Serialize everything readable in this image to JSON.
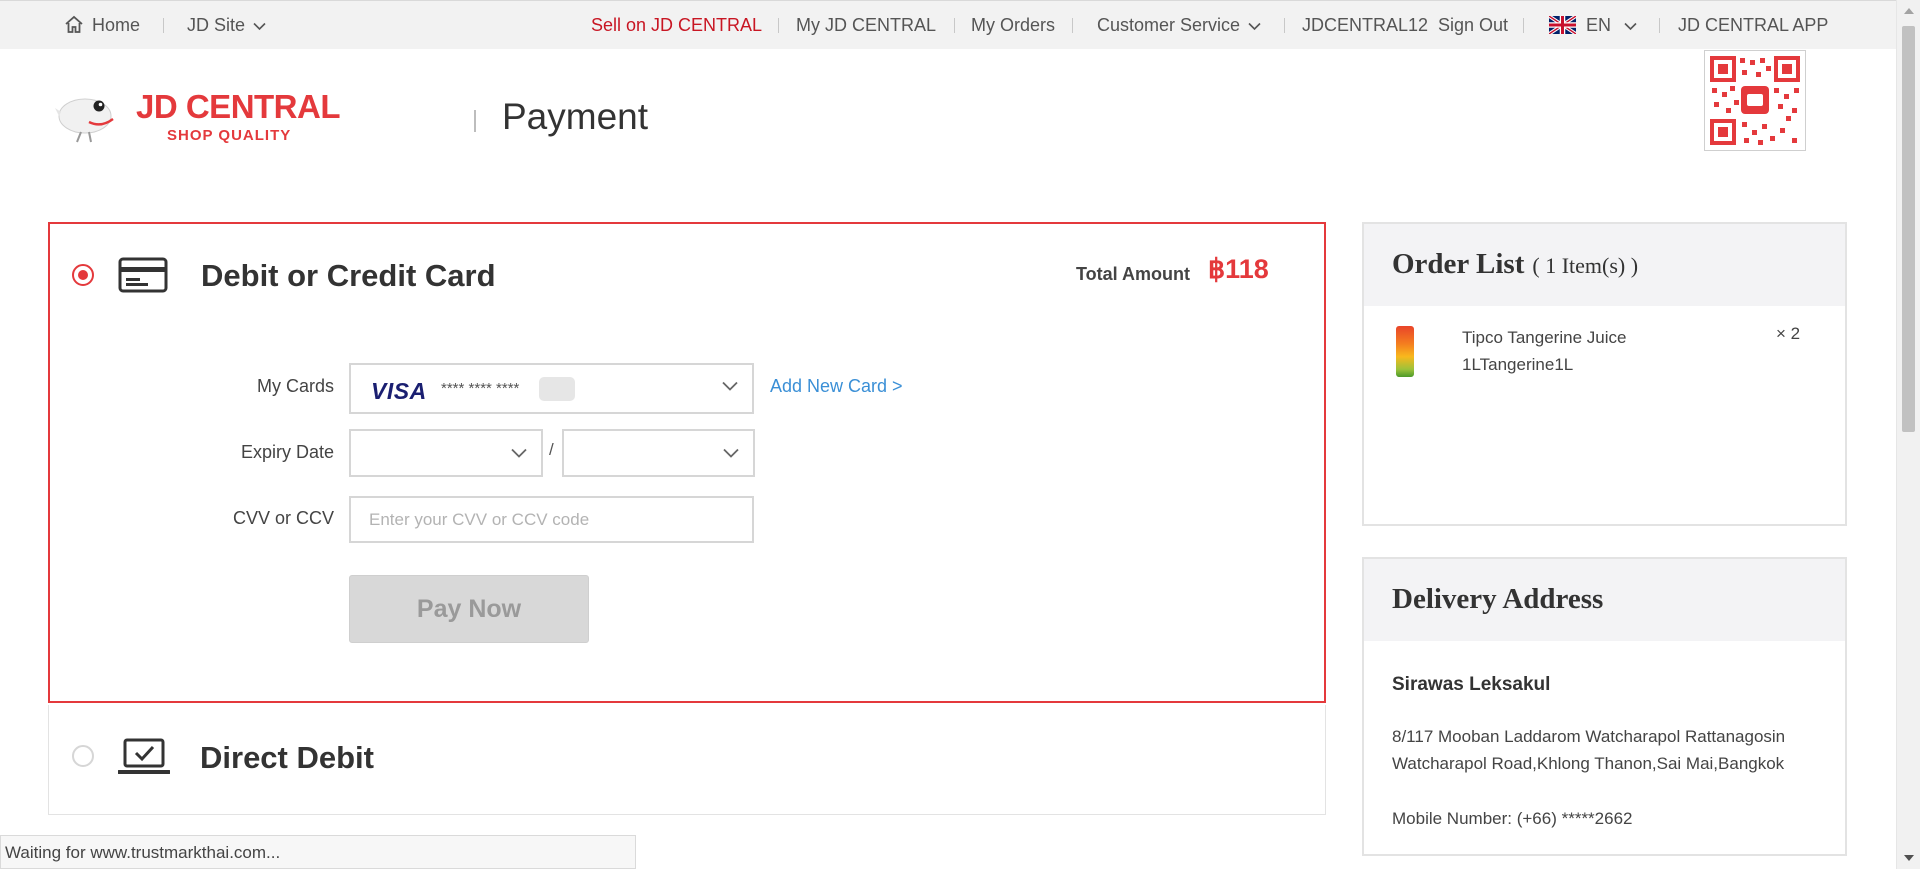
{
  "topbar": {
    "home": "Home",
    "site": "JD Site",
    "sell": "Sell on JD CENTRAL",
    "my_account": "My JD CENTRAL",
    "my_orders": "My Orders",
    "customer_service": "Customer Service",
    "username": "JDCENTRAL12",
    "sign_out": "Sign Out",
    "language": "EN",
    "app": "JD CENTRAL APP"
  },
  "header": {
    "logo_text": "JD CENTRAL",
    "logo_tagline": "SHOP QUALITY",
    "page_title": "Payment"
  },
  "payment": {
    "card_method": {
      "title": "Debit or Credit Card",
      "selected": true,
      "total_label": "Total Amount",
      "total_value": "฿118",
      "my_cards_label": "My Cards",
      "card_brand": "VISA",
      "card_masked": "**** **** ****",
      "add_card": "Add New Card >",
      "expiry_label": "Expiry Date",
      "expiry_month": "",
      "expiry_year": "",
      "expiry_separator": "/",
      "cvv_label": "CVV or CCV",
      "cvv_placeholder": "Enter your CVV or CCV code",
      "pay_button": "Pay Now"
    },
    "direct_debit": {
      "title": "Direct Debit",
      "selected": false
    }
  },
  "order_list": {
    "title": "Order List",
    "count": "( 1 Item(s) )",
    "items": [
      {
        "name": "Tipco Tangerine Juice 1LTangerine1L",
        "qty": "× 2"
      }
    ]
  },
  "delivery": {
    "title": "Delivery Address",
    "name": "Sirawas Leksakul",
    "address": "8/117 Mooban Laddarom Watcharapol Rattanagosin Watcharapol Road,Khlong Thanon,Sai Mai,Bangkok",
    "mobile": "Mobile Number: (+66) *****2662"
  },
  "status_bar": "Waiting for www.trustmarkthai.com...",
  "colors": {
    "brand_red": "#e4393c",
    "link_blue": "#3a8fd6",
    "topbar_bg": "#f2f2f2"
  }
}
